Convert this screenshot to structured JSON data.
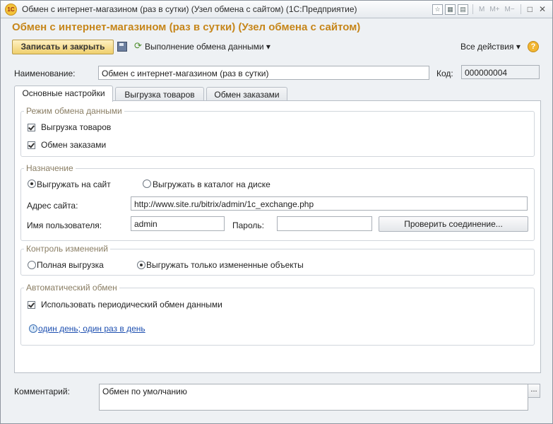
{
  "window": {
    "title": "Обмен с интернет-магазином (раз в сутки) (Узел обмена с сайтом)  (1С:Предприятие)",
    "app_icon": "1С",
    "toolbar_texts": [
      "M",
      "M+",
      "M−"
    ]
  },
  "header": {
    "title": "Обмен с интернет-магазином (раз в сутки) (Узел обмена с сайтом)"
  },
  "toolbar": {
    "save_close": "Записать и закрыть",
    "exchange": "Выполнение обмена данными",
    "all_actions": "Все действия",
    "help": "?"
  },
  "form": {
    "name_label": "Наименование:",
    "name_value": "Обмен с интернет-магазином (раз в сутки)",
    "code_label": "Код:",
    "code_value": "000000004"
  },
  "tabs": [
    {
      "label": "Основные настройки"
    },
    {
      "label": "Выгрузка товаров"
    },
    {
      "label": "Обмен заказами"
    }
  ],
  "mode": {
    "title": "Режим обмена данными",
    "export_goods": "Выгрузка товаров",
    "export_goods_checked": true,
    "exchange_orders": "Обмен заказами",
    "exchange_orders_checked": true
  },
  "destination": {
    "title": "Назначение",
    "to_site": "Выгружать на сайт",
    "to_disk": "Выгружать в каталог на диске",
    "selected": "to_site",
    "site_label": "Адрес сайта:",
    "site_value": "http://www.site.ru/bitrix/admin/1c_exchange.php",
    "user_label": "Имя пользователя:",
    "user_value": "admin",
    "password_label": "Пароль:",
    "password_value": "",
    "check_button": "Проверить соединение..."
  },
  "changes": {
    "title": "Контроль изменений",
    "full": "Полная выгрузка",
    "only_changed": "Выгружать только измененные объекты",
    "selected": "only_changed"
  },
  "auto": {
    "title": "Автоматический обмен",
    "periodic": "Использовать периодический обмен данными",
    "periodic_checked": true,
    "schedule_link": "один день; один раз в день"
  },
  "comment": {
    "label": "Комментарий:",
    "value": "Обмен по умолчанию",
    "button": "..."
  },
  "icons": [
    "app-1c-icon",
    "favorites-icon",
    "calculator-icon",
    "calendar-icon",
    "minimize-icon",
    "restore-icon",
    "close-icon",
    "save-icon",
    "exchange-icon",
    "dropdown-arrow-icon",
    "help-icon",
    "schedule-icon"
  ]
}
